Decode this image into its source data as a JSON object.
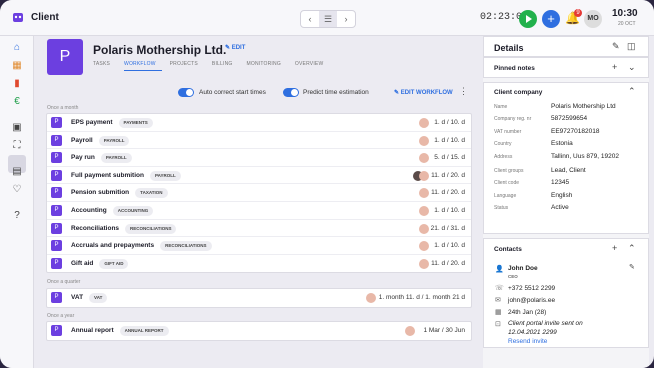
{
  "app": {
    "title": "Client",
    "timer": "02:23:00",
    "notif_count": "9",
    "user_initials": "MO",
    "clock": "10:30",
    "date": "20 OCT"
  },
  "client": {
    "initial": "P",
    "name": "Polaris Mothership Ltd.",
    "edit_label": "EDIT"
  },
  "tabs": [
    "TASKS",
    "WORKFLOW",
    "PROJECTS",
    "BILLING",
    "MONITORING",
    "OVERVIEW"
  ],
  "toolbar": {
    "auto_correct": "Auto correct start times",
    "predict": "Predict time estimation",
    "edit_workflow": "EDIT WORKFLOW"
  },
  "sections": {
    "monthly": "Once a month",
    "quarterly": "Once a quarter",
    "yearly": "Once a year"
  },
  "monthly_tasks": [
    {
      "name": "EPS payment",
      "tag": "PAYMENTS",
      "due": "1. d / 10. d"
    },
    {
      "name": "Payroll",
      "tag": "PAYROLL",
      "due": "1. d / 10. d"
    },
    {
      "name": "Pay run",
      "tag": "PAYROLL",
      "due": "5. d / 15. d"
    },
    {
      "name": "Full payment submition",
      "tag": "PAYROLL",
      "due": "11. d / 20. d"
    },
    {
      "name": "Pension submition",
      "tag": "TAXATION",
      "due": "11. d / 20. d"
    },
    {
      "name": "Accounting",
      "tag": "ACCOUNTING",
      "due": "1. d / 10. d"
    },
    {
      "name": "Reconciliations",
      "tag": "RECONCILIATIONS",
      "due": "21. d / 31. d"
    },
    {
      "name": "Accruals and prepayments",
      "tag": "RECONCILIATIONS",
      "due": "1. d / 10. d"
    },
    {
      "name": "Gift aid",
      "tag": "GIFT AID",
      "due": "11. d / 20. d"
    }
  ],
  "quarterly_tasks": [
    {
      "name": "VAT",
      "tag": "VAT",
      "due": "1. month 11. d / 1. month 21 d"
    }
  ],
  "yearly_tasks": [
    {
      "name": "Annual report",
      "tag": "ANNUAL REPORT",
      "due": "1 Mar / 30 Jun"
    }
  ],
  "details": {
    "title": "Details",
    "pinned_notes": "Pinned notes",
    "client_company": "Client company",
    "fields": [
      {
        "key": "Name",
        "value": "Polaris Mothership Ltd"
      },
      {
        "key": "Company reg. nr",
        "value": "5872599654"
      },
      {
        "key": "VAT number",
        "value": "EE97270182018"
      },
      {
        "key": "Country",
        "value": "Estonia"
      },
      {
        "key": "Address",
        "value": "Tallinn, Uus  879, 19202"
      }
    ],
    "fields2": [
      {
        "key": "Client groups",
        "value": "Lead, Client"
      },
      {
        "key": "Client code",
        "value": "12345"
      },
      {
        "key": "Language",
        "value": "English"
      },
      {
        "key": "Status",
        "value": "Active"
      }
    ],
    "contacts_title": "Contacts",
    "contact": {
      "name": "John Doe",
      "role": "CEO",
      "phone": "+372 5512 2299",
      "email": "john@polaris.ee",
      "birthday": "24th Jan (28)",
      "portal_note": "Client portal invite sent on 12.04.2021 2299",
      "resend": "Resend invite"
    }
  },
  "colors": {
    "accent": "#2f6fe0",
    "client_purple": "#6c3fe0",
    "play_green": "#22b14c"
  }
}
